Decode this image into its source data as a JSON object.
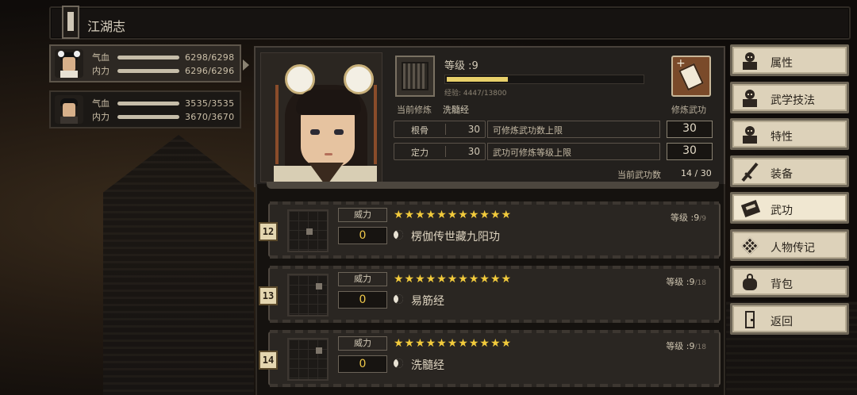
{
  "topbar": {
    "title": "江湖志",
    "book_icon": "scroll-book-icon"
  },
  "party": [
    {
      "hp_label": "气血",
      "hp": "6298/6298",
      "mp_label": "内力",
      "mp": "6296/6296",
      "active": true
    },
    {
      "hp_label": "气血",
      "hp": "3535/3535",
      "mp_label": "内力",
      "mp": "3670/3670",
      "active": false
    }
  ],
  "main": {
    "level_label": "等级 :9",
    "exp_text": "经验: 4447/13800",
    "exp_progress": 0.322,
    "cur_train_label": "当前修炼",
    "cur_train_value": "洗髓经",
    "learn_label": "修炼武功",
    "attrs": [
      {
        "name": "根骨",
        "num": "30",
        "desc": "可修炼武功数上限",
        "value": "30"
      },
      {
        "name": "定力",
        "num": "30",
        "desc": "武功可修炼等级上限",
        "value": "30"
      }
    ],
    "count_label": "当前武功数",
    "count_value": "14 / 30"
  },
  "skills": [
    {
      "index": "12",
      "power_label": "威力",
      "power": "0",
      "stars": "★★★★★★★★★★★",
      "star_count": 11,
      "name": "楞伽传世藏九阳功",
      "level": "等级 :9",
      "level_max": "/9"
    },
    {
      "index": "13",
      "power_label": "威力",
      "power": "0",
      "stars": "★★★★★★★★★★★",
      "star_count": 11,
      "name": "易筋经",
      "level": "等级 :9",
      "level_max": "/18"
    },
    {
      "index": "14",
      "power_label": "威力",
      "power": "0",
      "stars": "★★★★★★★★★★★",
      "star_count": 11,
      "name": "洗髓经",
      "level": "等级 :9",
      "level_max": "/18"
    }
  ],
  "menu": [
    {
      "label": "属性",
      "icon": "person-icon"
    },
    {
      "label": "武学技法",
      "icon": "person-icon"
    },
    {
      "label": "特性",
      "icon": "person-icon"
    },
    {
      "label": "装备",
      "icon": "sword-icon"
    },
    {
      "label": "武功",
      "icon": "book-icon",
      "active": true
    },
    {
      "label": "人物传记",
      "icon": "scroll-icon"
    },
    {
      "label": "背包",
      "icon": "bag-icon"
    },
    {
      "label": "返回",
      "icon": "door-icon"
    }
  ],
  "colors": {
    "exp_bar": "#e8d06a",
    "stars": "#f2cb3c",
    "power": "#f0c94a",
    "menu_bg": "#ddd2ba"
  }
}
